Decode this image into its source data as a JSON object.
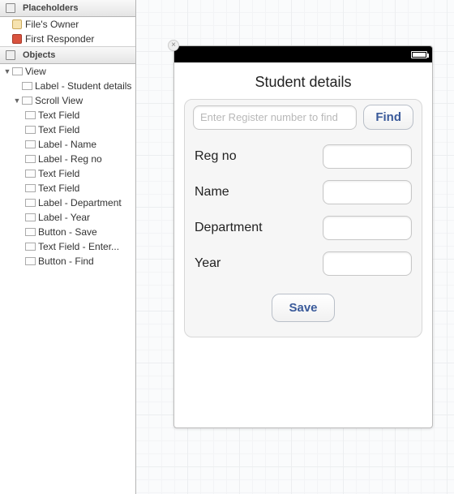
{
  "outline": {
    "placeholders_header": "Placeholders",
    "placeholders": [
      {
        "label": "File's Owner"
      },
      {
        "label": "First Responder"
      }
    ],
    "objects_header": "Objects",
    "tree": {
      "view": "View",
      "children": [
        "Label - Student details",
        "Scroll View"
      ],
      "scrollview_children": [
        "Text Field",
        "Text Field",
        "Label - Name",
        "Label - Reg no",
        "Text Field",
        "Text Field",
        "Label - Department",
        "Label - Year",
        "Button - Save",
        "Text Field - Enter...",
        "Button - Find"
      ]
    }
  },
  "device": {
    "title": "Student details",
    "search_placeholder": "Enter Register number to find",
    "find_label": "Find",
    "fields": {
      "regno_label": "Reg no",
      "name_label": "Name",
      "department_label": "Department",
      "year_label": "Year"
    },
    "save_label": "Save"
  }
}
